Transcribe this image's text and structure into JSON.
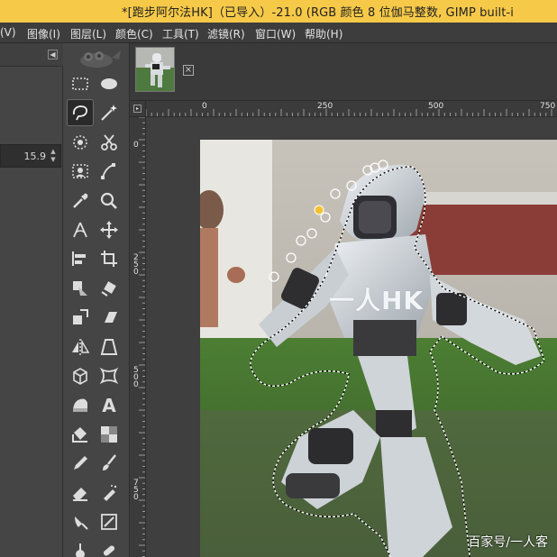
{
  "window": {
    "title": "*[跑步阿尔法HK]（已导入）-21.0 (RGB 颜色 8 位伽马整数, GIMP built-i"
  },
  "menu": {
    "items": [
      "(V)",
      "图像(I)",
      "图层(L)",
      "颜色(C)",
      "工具(T)",
      "滤镜(R)",
      "窗口(W)",
      "帮助(H)"
    ]
  },
  "left_dock": {
    "collapse_icon": "triangle-left-icon",
    "size_value": "15.9"
  },
  "toolbox": {
    "tools": [
      "rect-select-icon",
      "ellipse-select-icon",
      "free-select-icon",
      "fuzzy-select-icon",
      "by-color-select-icon",
      "scissors-select-icon",
      "foreground-select-icon",
      "paths-icon",
      "color-picker-icon",
      "zoom-icon",
      "measure-icon",
      "move-icon",
      "align-icon",
      "crop-icon",
      "unified-transform-icon",
      "rotate-icon",
      "scale-icon",
      "shear-icon",
      "flip-icon",
      "perspective-icon",
      "3d-transform-icon",
      "warp-icon",
      "cage-icon",
      "text-icon",
      "bucket-fill-icon",
      "gradient-icon",
      "pencil-icon",
      "paintbrush-icon",
      "eraser-icon",
      "airbrush-icon",
      "ink-icon",
      "mypaint-brush-icon",
      "clone-icon",
      "heal-icon"
    ],
    "active_tool": "free-select-icon"
  },
  "image_tabs": {
    "close_icon": "close-box-icon"
  },
  "rulers": {
    "horizontal": [
      "0",
      "250",
      "500",
      "750"
    ],
    "vertical": [
      "0",
      "250",
      "500",
      "750"
    ]
  },
  "canvas": {
    "image_text": "一人HK",
    "watermark": "百家号/一人客"
  },
  "colors": {
    "titlebar": "#f7c948",
    "menubar": "#3d3d3d",
    "panel": "#454545",
    "canvas_bg": "#3f3f3f"
  }
}
